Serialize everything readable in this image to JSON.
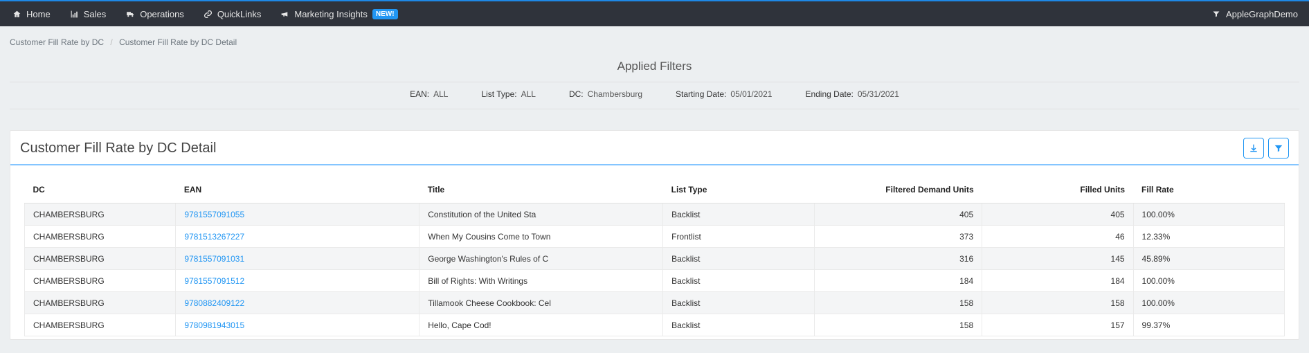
{
  "nav": {
    "items": [
      {
        "label": "Home",
        "icon": "home-icon"
      },
      {
        "label": "Sales",
        "icon": "chart-icon"
      },
      {
        "label": "Operations",
        "icon": "truck-icon"
      },
      {
        "label": "QuickLinks",
        "icon": "link-icon"
      },
      {
        "label": "Marketing Insights",
        "icon": "bullhorn-icon",
        "badge": "NEW!"
      }
    ],
    "user": "AppleGraphDemo"
  },
  "breadcrumb": {
    "parent": "Customer Fill Rate by DC",
    "current": "Customer Fill Rate by DC Detail"
  },
  "filters": {
    "title": "Applied Filters",
    "pairs": [
      {
        "label": "EAN:",
        "value": "ALL"
      },
      {
        "label": "List Type:",
        "value": "ALL"
      },
      {
        "label": "DC:",
        "value": "Chambersburg"
      },
      {
        "label": "Starting Date:",
        "value": "05/01/2021"
      },
      {
        "label": "Ending Date:",
        "value": "05/31/2021"
      }
    ]
  },
  "panel": {
    "title": "Customer Fill Rate by DC Detail"
  },
  "table": {
    "columns": [
      "DC",
      "EAN",
      "Title",
      "List Type",
      "Filtered Demand Units",
      "Filled Units",
      "Fill Rate"
    ],
    "rows": [
      {
        "dc": "CHAMBERSBURG",
        "ean": "9781557091055",
        "title": "Constitution of the United Sta",
        "listType": "Backlist",
        "demand": "405",
        "filled": "405",
        "rate": "100.00%"
      },
      {
        "dc": "CHAMBERSBURG",
        "ean": "9781513267227",
        "title": "When My Cousins Come to Town",
        "listType": "Frontlist",
        "demand": "373",
        "filled": "46",
        "rate": "12.33%"
      },
      {
        "dc": "CHAMBERSBURG",
        "ean": "9781557091031",
        "title": "George Washington's Rules of C",
        "listType": "Backlist",
        "demand": "316",
        "filled": "145",
        "rate": "45.89%"
      },
      {
        "dc": "CHAMBERSBURG",
        "ean": "9781557091512",
        "title": "Bill of Rights: With Writings",
        "listType": "Backlist",
        "demand": "184",
        "filled": "184",
        "rate": "100.00%"
      },
      {
        "dc": "CHAMBERSBURG",
        "ean": "9780882409122",
        "title": "Tillamook Cheese Cookbook: Cel",
        "listType": "Backlist",
        "demand": "158",
        "filled": "158",
        "rate": "100.00%"
      },
      {
        "dc": "CHAMBERSBURG",
        "ean": "9780981943015",
        "title": "Hello, Cape Cod!",
        "listType": "Backlist",
        "demand": "158",
        "filled": "157",
        "rate": "99.37%"
      }
    ]
  }
}
